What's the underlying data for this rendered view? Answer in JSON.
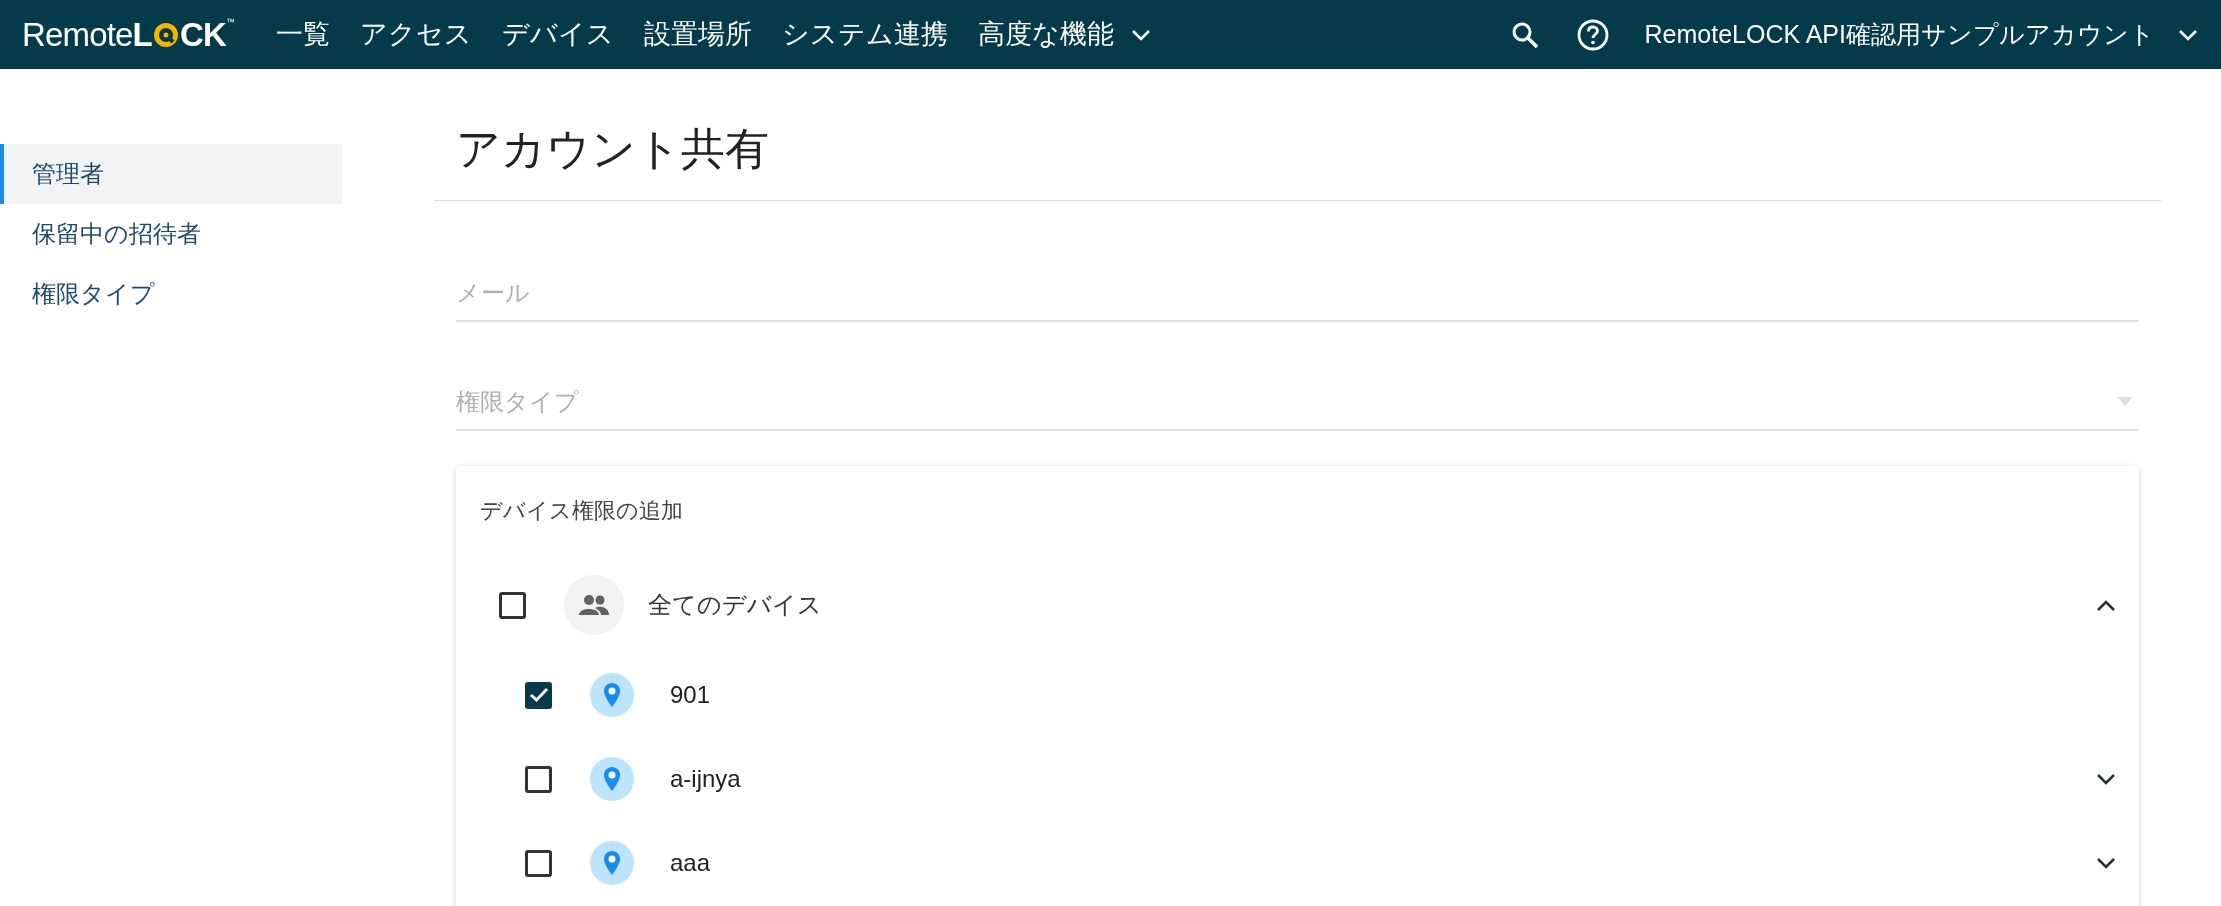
{
  "header": {
    "logo": {
      "light": "Remote",
      "bold_before": "L",
      "bold_after": "CK",
      "mark": "™"
    },
    "nav": [
      {
        "label": "一覧",
        "dropdown": false
      },
      {
        "label": "アクセス",
        "dropdown": false
      },
      {
        "label": "デバイス",
        "dropdown": false
      },
      {
        "label": "設置場所",
        "dropdown": false
      },
      {
        "label": "システム連携",
        "dropdown": false
      },
      {
        "label": "高度な機能",
        "dropdown": true
      }
    ],
    "account": "RemoteLOCK API確認用サンプルアカウント"
  },
  "sidebar": {
    "items": [
      {
        "label": "管理者",
        "selected": true
      },
      {
        "label": "保留中の招待者",
        "selected": false
      },
      {
        "label": "権限タイプ",
        "selected": false
      }
    ]
  },
  "main": {
    "title": "アカウント共有",
    "email_field": {
      "placeholder": "メール"
    },
    "permission_select": {
      "placeholder": "権限タイプ"
    },
    "device_card": {
      "heading": "デバイス権限の追加",
      "tree": [
        {
          "label": "全てのデバイス",
          "kind": "group",
          "checked": false,
          "expanded": true,
          "children": [
            {
              "label": "901",
              "kind": "device",
              "checked": true
            },
            {
              "label": "a-ijnya",
              "kind": "device",
              "checked": false,
              "expanded": false
            },
            {
              "label": "aaa",
              "kind": "device",
              "checked": false,
              "expanded": false
            }
          ]
        }
      ]
    }
  }
}
